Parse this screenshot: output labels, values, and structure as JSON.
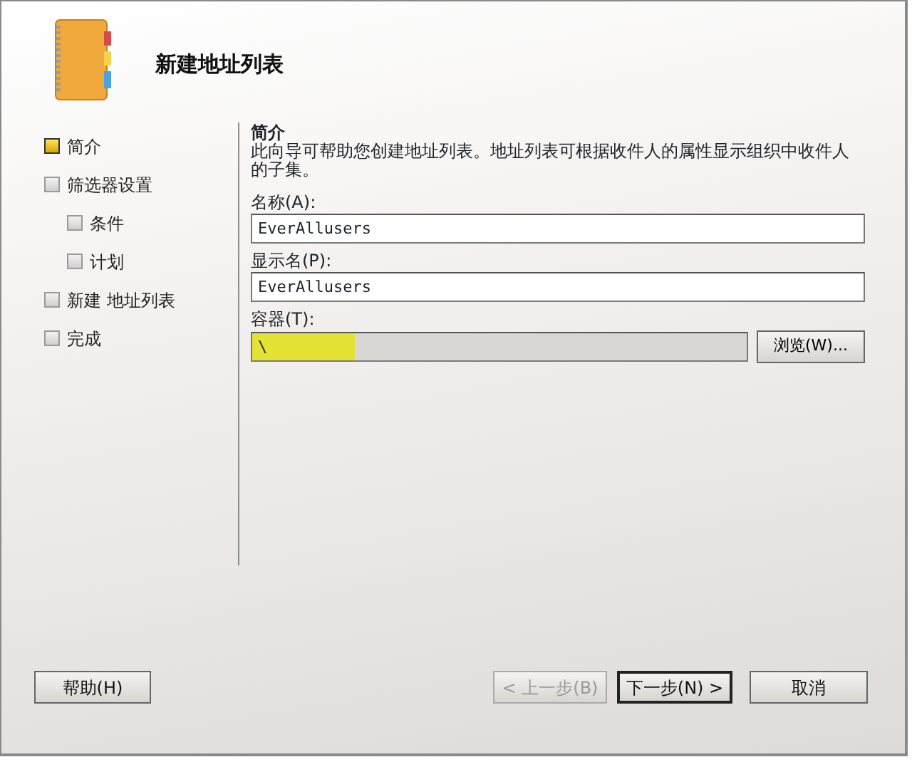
{
  "window": {
    "title": "新建地址列表"
  },
  "steps": [
    {
      "label": "简介",
      "selected": true
    },
    {
      "label": "筛选器设置",
      "selected": false,
      "children": [
        {
          "label": "条件",
          "selected": false
        },
        {
          "label": "计划",
          "selected": false
        }
      ]
    },
    {
      "label": "新建 地址列表",
      "selected": false
    },
    {
      "label": "完成",
      "selected": false
    }
  ],
  "section": {
    "heading": "简介",
    "description": "此向导可帮助您创建地址列表。地址列表可根据收件人的属性显示组织中收件人的子集。"
  },
  "fields": [
    {
      "label": "名称(A):",
      "value": "EverAllusers",
      "readonly": false,
      "highlighted": false
    },
    {
      "label": "显示名(P):",
      "value": "EverAllusers",
      "readonly": false,
      "highlighted": false
    },
    {
      "label": "容器(T):",
      "value": "\\",
      "readonly": true,
      "highlighted": true,
      "button": "浏览(W)..."
    }
  ],
  "buttons": {
    "help": "帮助(H)",
    "back": {
      "label": "< 上一步(B)",
      "disabled": true
    },
    "next": {
      "label": "下一步(N) >",
      "default": true
    },
    "cancel": "取消"
  }
}
